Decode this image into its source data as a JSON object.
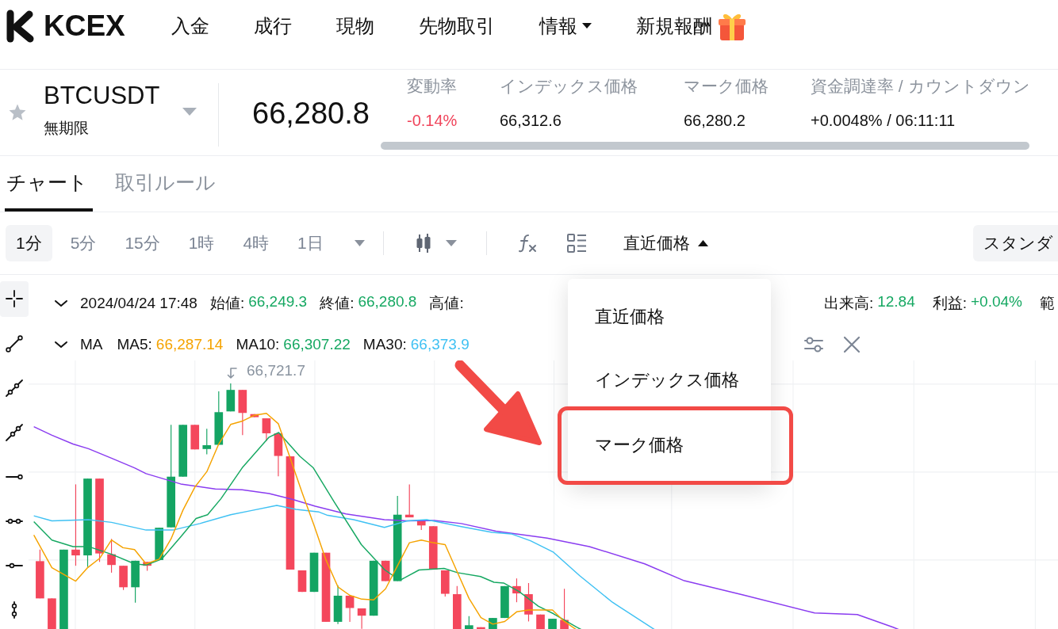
{
  "nav": {
    "logo": "KCEX",
    "items": [
      {
        "label": "入金",
        "kind": "link"
      },
      {
        "label": "成行",
        "kind": "link"
      },
      {
        "label": "現物",
        "kind": "link"
      },
      {
        "label": "先物取引",
        "kind": "link"
      },
      {
        "label": "情報",
        "kind": "menu"
      },
      {
        "label": "新規報酬",
        "kind": "gift"
      }
    ]
  },
  "ticker": {
    "symbol": "BTCUSDT",
    "favorite": false,
    "contract": "無期限",
    "last_price": "66,280.8",
    "stats": [
      {
        "label": "変動率",
        "value": "-0.14%",
        "color": "#f0445b"
      },
      {
        "label": "インデックス価格",
        "value": "66,312.6",
        "color": "#111111"
      },
      {
        "label": "マーク価格",
        "value": "66,280.2",
        "color": "#111111"
      },
      {
        "label": "資金調達率 / カウントダウン",
        "value": "+0.0048% / 06:11:11",
        "color": "#111111"
      }
    ]
  },
  "tabs": [
    {
      "label": "チャート",
      "selected": true
    },
    {
      "label": "取引ルール",
      "selected": false
    }
  ],
  "toolbar": {
    "intervals": [
      {
        "label": "1分",
        "selected": true
      },
      {
        "label": "5分",
        "selected": false
      },
      {
        "label": "15分",
        "selected": false
      },
      {
        "label": "1時",
        "selected": false
      },
      {
        "label": "4時",
        "selected": false
      },
      {
        "label": "1日",
        "selected": false
      }
    ],
    "price_source": {
      "label": "直近価格",
      "expanded": true,
      "options": [
        {
          "label": "直近価格",
          "annotated": false
        },
        {
          "label": "インデックス価格",
          "annotated": false
        },
        {
          "label": "マーク価格",
          "annotated": true
        }
      ]
    },
    "layout_button": {
      "label": "スタンダ"
    }
  },
  "drawing_tools": [
    {
      "kind": "crosshair",
      "selected": true
    },
    {
      "kind": "segment",
      "selected": false
    },
    {
      "kind": "ray",
      "selected": false
    },
    {
      "kind": "extended",
      "selected": false
    },
    {
      "kind": "hray",
      "selected": false
    },
    {
      "kind": "hline",
      "selected": false
    },
    {
      "kind": "hsegment",
      "selected": false
    },
    {
      "kind": "vline",
      "selected": false
    }
  ],
  "chart": {
    "ohlc": {
      "time": "2024/04/24 17:48",
      "left": [
        {
          "label": "始値:",
          "value": "66,249.3"
        },
        {
          "label": "終値:",
          "value": "66,280.8"
        },
        {
          "label": "高値:"
        }
      ],
      "right": [
        {
          "label": "出来高:",
          "value": "12.84"
        },
        {
          "label": "利益:",
          "value": "+0.04%"
        },
        {
          "label": "範"
        }
      ]
    },
    "ma": {
      "label": "MA",
      "lines": [
        {
          "label": "MA5:",
          "value": "66,287.14",
          "color": "#f5a300"
        },
        {
          "label": "MA10:",
          "value": "66,307.22",
          "color": "#16a862"
        },
        {
          "label": "MA30:",
          "value": "66,373.9",
          "color": "#3fc1f3"
        }
      ]
    },
    "high_label": "66,721.7"
  }
}
